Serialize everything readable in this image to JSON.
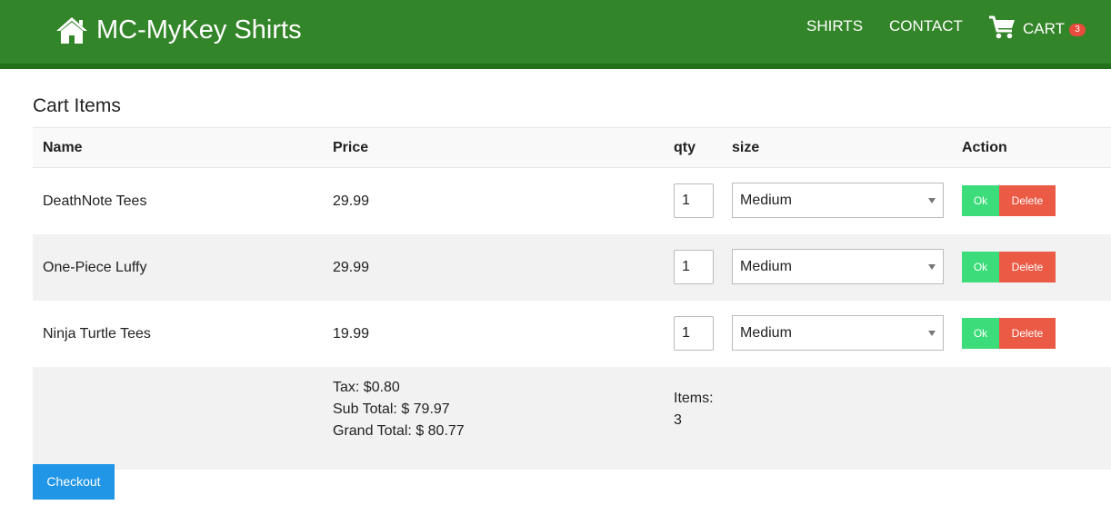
{
  "navbar": {
    "brand": "MC-MyKey Shirts",
    "brand_icon": "home-icon",
    "links": {
      "shirts": "SHIRTS",
      "contact": "CONTACT",
      "cart": "CART"
    },
    "cart_icon": "shopping-cart-icon",
    "cart_count": "3",
    "colors": {
      "background": "#338529",
      "badge": "#e74c3c"
    }
  },
  "page": {
    "title": "Cart Items"
  },
  "table": {
    "headers": {
      "name": "Name",
      "price": "Price",
      "qty": "qty",
      "size": "size",
      "action": "Action"
    },
    "rows": [
      {
        "name": "DeathNote Tees",
        "price": "29.99",
        "qty": "1",
        "size": "Medium",
        "ok": "Ok",
        "delete": "Delete"
      },
      {
        "name": "One-Piece Luffy",
        "price": "29.99",
        "qty": "1",
        "size": "Medium",
        "ok": "Ok",
        "delete": "Delete"
      },
      {
        "name": "Ninja Turtle Tees",
        "price": "19.99",
        "qty": "1",
        "size": "Medium",
        "ok": "Ok",
        "delete": "Delete"
      }
    ],
    "summary": {
      "tax": "Tax: $0.80",
      "sub_total": "Sub Total: $ 79.97",
      "grand_total": "Grand Total: $ 80.77",
      "items_label": "Items:",
      "items_count": "3"
    }
  },
  "checkout": {
    "label": "Checkout",
    "color": "#2196e6"
  },
  "button_colors": {
    "ok": "#3ddc7a",
    "delete": "#ea5a45"
  }
}
